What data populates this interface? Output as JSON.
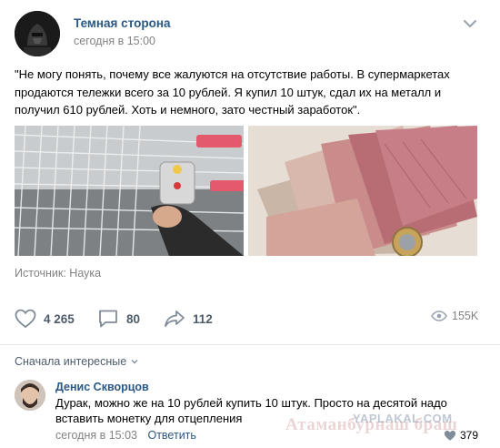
{
  "post": {
    "author": "Темная сторона",
    "date": "сегодня в 15:00",
    "text": "\"Не могу понять, почему все жалуются на отсутствие работы. В супермаркетах продаются тележки всего за 10 рублей. Я купил 10 штук, сдал их на металл и получил 610 рублей. Хоть и немного, зато честный заработок\".",
    "source": "Источник: Наука",
    "likes": "4 265",
    "comments": "80",
    "shares": "112",
    "views": "155K"
  },
  "comments_section": {
    "sort_label": "Сначала интересные",
    "comment": {
      "author": "Денис Скворцов",
      "text": "Дурак, можно же на 10 рублей купить 10 штук. Просто на десятой надо вставить монетку для отцепления",
      "date": "сегодня в 15:03",
      "reply_label": "Ответить",
      "likes": "379"
    }
  },
  "watermark": {
    "site": "YAPLAKAL.COM",
    "overlay": "Атаманбурнаш браш"
  },
  "colors": {
    "link": "#2a5885",
    "secondary": "#828282",
    "action": "#4d5b6b"
  }
}
